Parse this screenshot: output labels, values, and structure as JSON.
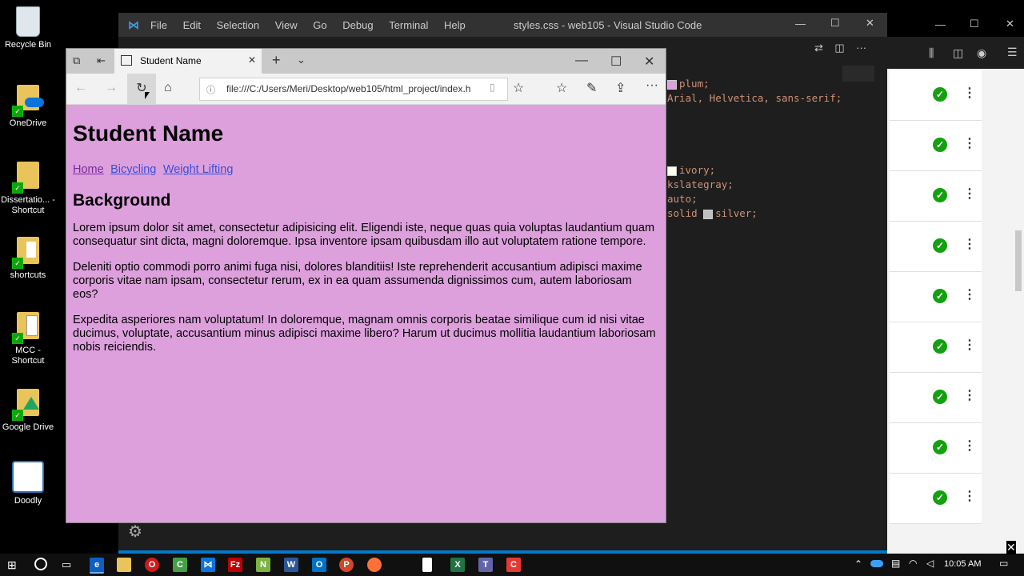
{
  "desktop": {
    "icons": [
      {
        "label": "Recycle Bin",
        "icon": "recycle-bin-icon"
      },
      {
        "label": "OneDrive",
        "icon": "onedrive-icon"
      },
      {
        "label": "Dissertatio... - Shortcut",
        "icon": "folder-icon"
      },
      {
        "label": "shortcuts",
        "icon": "folder-icon"
      },
      {
        "label": "MCC - Shortcut",
        "icon": "folder-icon"
      },
      {
        "label": "Google Drive",
        "icon": "google-drive-icon"
      },
      {
        "label": "Doodly",
        "icon": "doodly-icon"
      }
    ]
  },
  "vscode": {
    "title": "styles.css - web105 - Visual Studio Code",
    "menu": [
      "File",
      "Edit",
      "Selection",
      "View",
      "Go",
      "Debug",
      "Terminal",
      "Help"
    ],
    "code_lines": [
      {
        "swatch": "#dda0dd",
        "text": "plum;"
      },
      {
        "swatch": "",
        "text": "Arial, Helvetica, sans-serif;"
      },
      {
        "swatch": "#fffff0",
        "text": "ivory;"
      },
      {
        "swatch": "",
        "text": "kslategray;"
      },
      {
        "swatch": "",
        "text": "auto;"
      },
      {
        "swatch_prefix": "solid ",
        "swatch": "#c0c0c0",
        "text": "silver;"
      }
    ]
  },
  "browser": {
    "tab_title": "Student Name",
    "url": "file:///C:/Users/Meri/Desktop/web105/html_project/index.h",
    "page": {
      "heading": "Student Name",
      "nav_links": [
        "Home",
        "Bicycling",
        "Weight Lifting"
      ],
      "subheading": "Background",
      "paragraphs": [
        "Lorem ipsum dolor sit amet, consectetur adipisicing elit. Eligendi iste, neque quas quia voluptas laudantium quam consequatur sint dicta, magni doloremque. Ipsa inventore ipsam quibusdam illo aut voluptatem ratione tempore.",
        "Deleniti optio commodi porro animi fuga nisi, dolores blanditiis! Iste reprehenderit accusantium adipisci maxime corporis vitae nam ipsam, consectetur rerum, ex in ea quam assumenda dignissimos cum, autem laboriosam eos?",
        "Expedita asperiores nam voluptatum! In doloremque, magnam omnis corporis beatae similique cum id nisi vitae ducimus, voluptate, accusantium minus adipisci maxime libero? Harum ut ducimus mollitia laudantium laboriosam nobis reiciendis."
      ]
    }
  },
  "taskbar": {
    "time": "10:05 AM"
  },
  "colors": {
    "page_bg": "#dda0dd",
    "link": "#3a4fd6",
    "link_visited": "#7a2a9c",
    "vscode_bg": "#1e1e1e",
    "check_green": "#13a10e"
  }
}
